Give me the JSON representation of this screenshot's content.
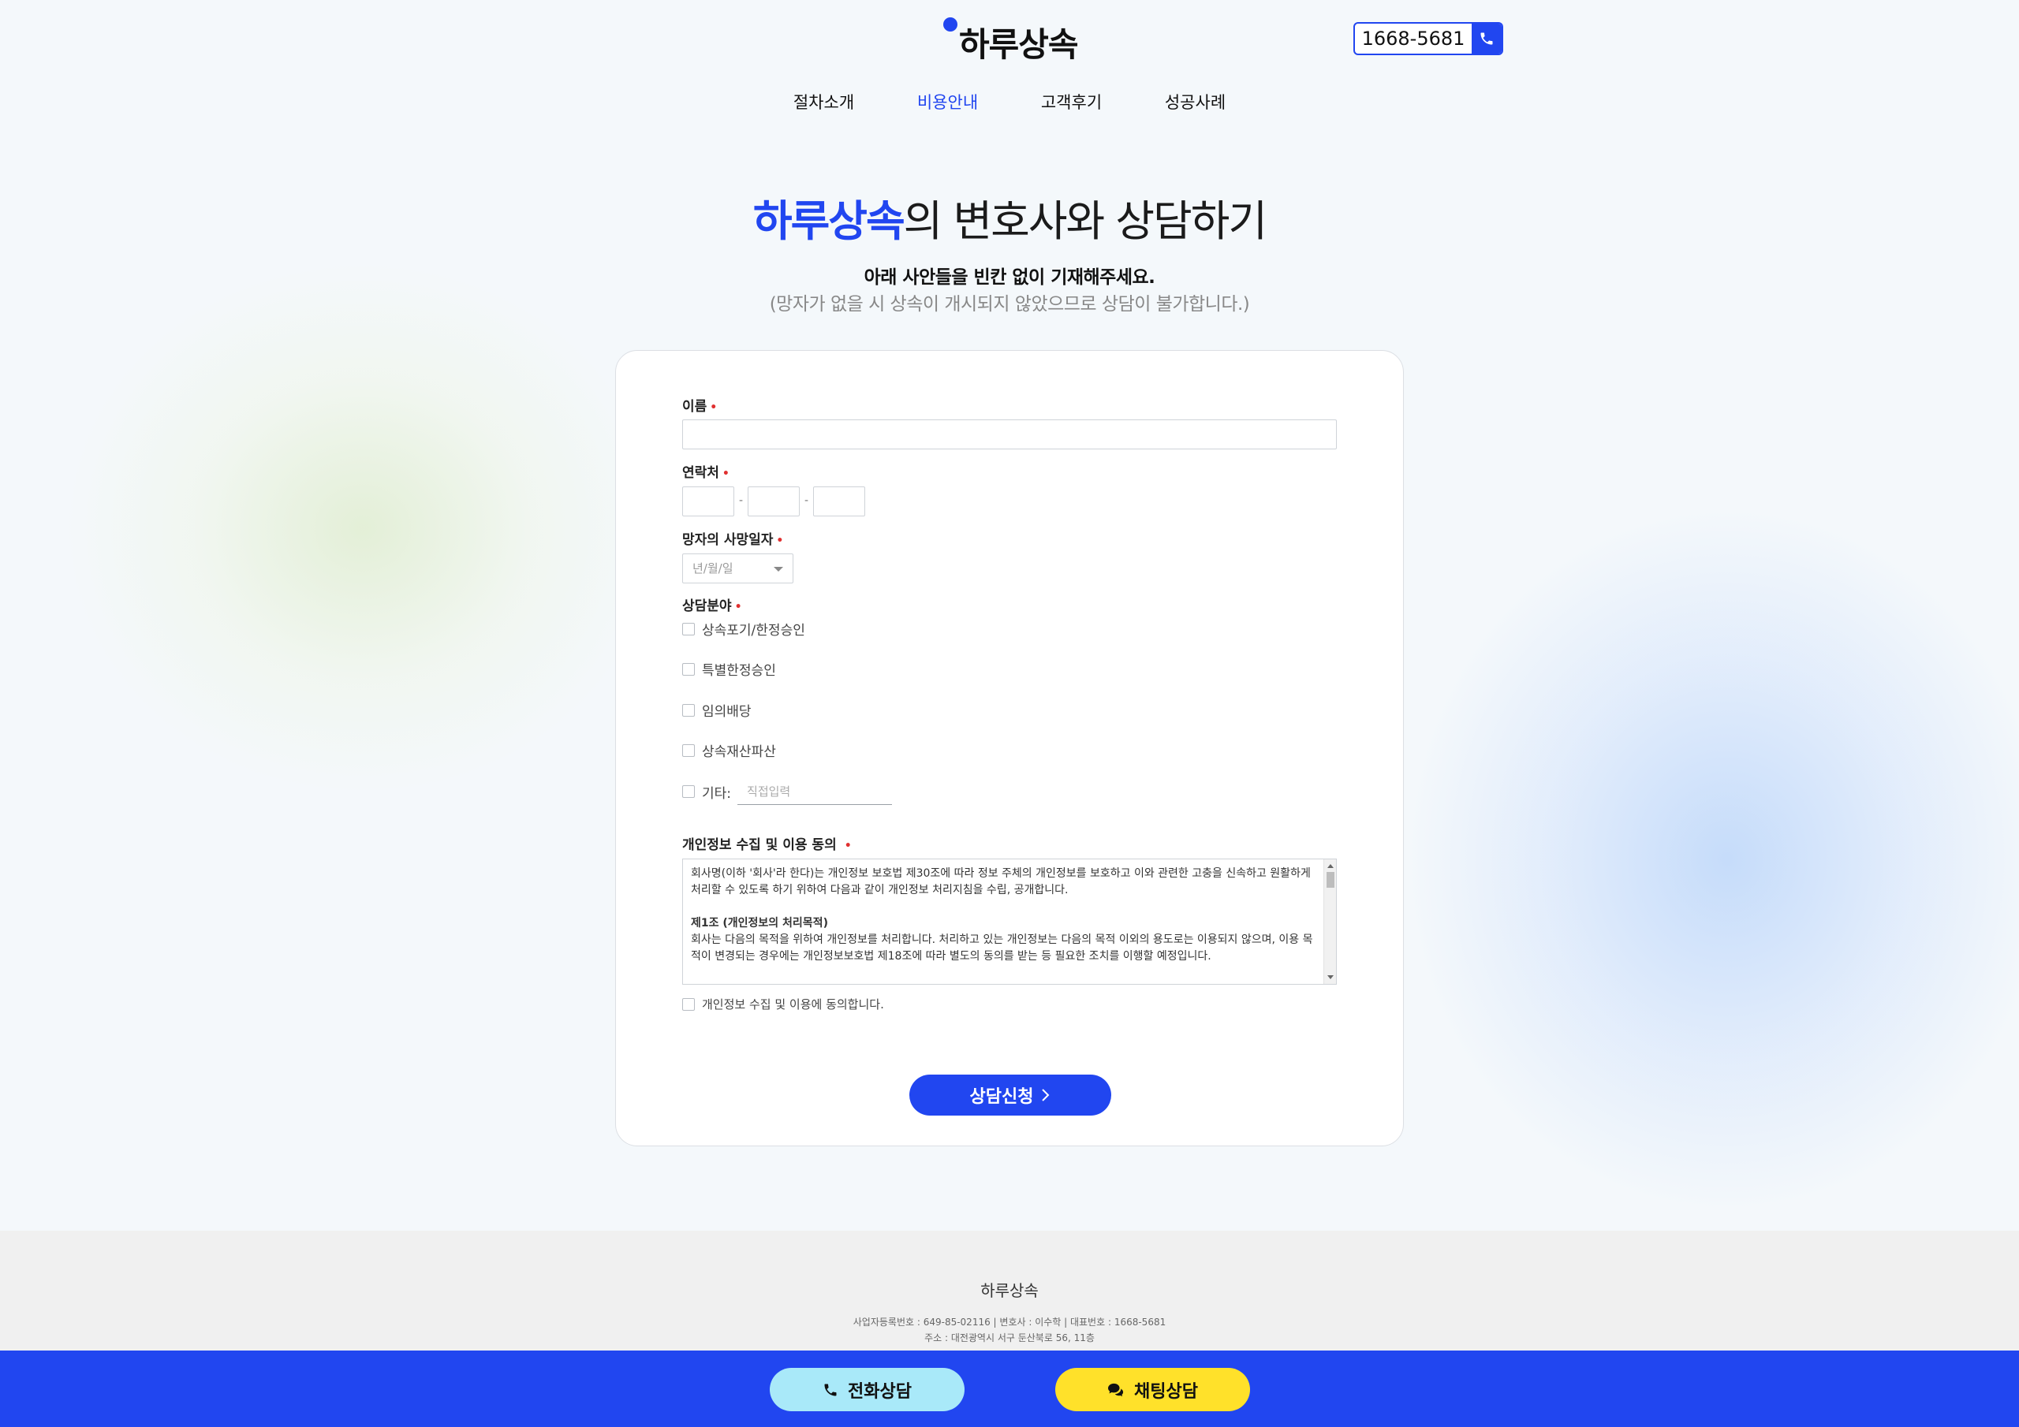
{
  "header": {
    "logo_text": "하루상속",
    "phone_number": "1668-5681"
  },
  "nav": {
    "items": [
      {
        "label": "절차소개",
        "active": false
      },
      {
        "label": "비용안내",
        "active": true
      },
      {
        "label": "고객후기",
        "active": false
      },
      {
        "label": "성공사례",
        "active": false
      }
    ]
  },
  "hero": {
    "title_accent": "하루상속",
    "title_rest": "의 변호사와 상담하기",
    "subtitle": "아래 사안들을 빈칸 없이 기재해주세요.",
    "subtitle_note": "(망자가 없을 시 상속이 개시되지 않았으므로 상담이 불가합니다.)"
  },
  "form": {
    "name_label": "이름",
    "contact_label": "연락처",
    "phone_separator": "-",
    "death_date_label": "망자의 사망일자",
    "death_date_placeholder": "년/월/일",
    "consult_field_label": "상담분야",
    "consult_options": [
      "상속포기/한정승인",
      "특별한정승인",
      "임의배당",
      "상속재산파산"
    ],
    "other_label": "기타:",
    "other_placeholder": "직접입력",
    "privacy_label": "개인정보 수집 및 이용 동의",
    "privacy_text_intro": "회사명(이하 '회사'라 한다)는 개인정보 보호법 제30조에 따라 정보 주체의 개인정보를 보호하고 이와 관련한 고충을 신속하고 원활하게 처리할 수 있도록 하기 위하여 다음과 같이 개인정보 처리지침을 수립, 공개합니다.",
    "privacy_section_title": "제1조 (개인정보의 처리목적)",
    "privacy_section_text": "회사는 다음의 목적을 위하여 개인정보를 처리합니다. 처리하고 있는 개인정보는 다음의 목적 이외의 용도로는 이용되지 않으며, 이용 목적이 변경되는 경우에는 개인정보보호법 제18조에 따라 별도의 동의를 받는 등 필요한 조치를 이행할 예정입니다.",
    "privacy_agree_label": "개인정보 수집 및 이용에 동의합니다.",
    "required_mark": "•",
    "submit_label": "상담신청"
  },
  "footer": {
    "company": "하루상속",
    "info": "사업자등록번호 : 649-85-02116  |  변호사 : 이수학  |  대표번호 : 1668-5681",
    "address": "주소 : 대전광역시 서구 둔산북로 56, 11층"
  },
  "bottom_bar": {
    "call_label": "전화상담",
    "chat_label": "채팅상담"
  },
  "colors": {
    "accent": "#2146f0",
    "call_button": "#a9e9f9",
    "chat_button": "#ffe12a"
  }
}
